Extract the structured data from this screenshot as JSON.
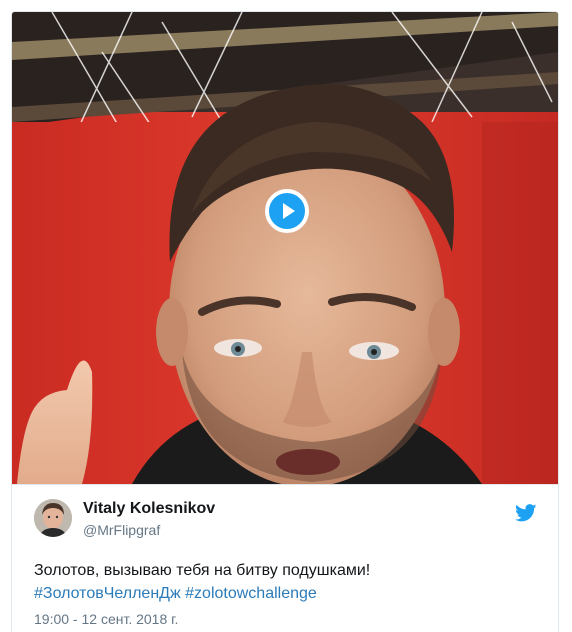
{
  "media": {
    "type": "video",
    "play_icon": "play-icon",
    "colors": {
      "background": "#d9352a",
      "play_button": "#1da1f2"
    }
  },
  "author": {
    "name": "Vitaly Kolesnikov",
    "handle": "@MrFlipgraf",
    "avatar_icon": "avatar"
  },
  "brand_icon": "twitter-bird-icon",
  "tweet": {
    "text": "Золотов, вызываю тебя на битву подушками!",
    "hashtags": [
      "#ЗолотовЧелленДж",
      "#zolotowchallenge"
    ],
    "hashtag_separator": " ",
    "timestamp": "19:00 - 12 сент. 2018 г."
  },
  "colors": {
    "link": "#2b7bb9",
    "muted": "#657786",
    "text": "#14171a",
    "brand": "#1da1f2"
  }
}
